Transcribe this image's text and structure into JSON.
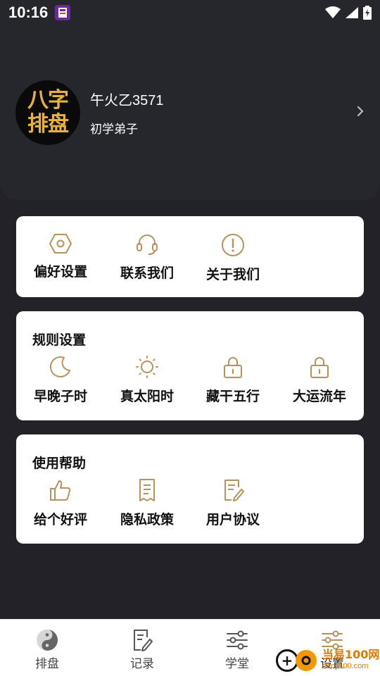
{
  "status_bar": {
    "time": "10:16"
  },
  "profile": {
    "avatar_line1": "八字",
    "avatar_line2": "排盘",
    "name": "午火乙3571",
    "level": "初学弟子"
  },
  "quick_card": {
    "items": [
      {
        "label": "偏好设置",
        "icon": "hexagon-nut-icon"
      },
      {
        "label": "联系我们",
        "icon": "headset-icon"
      },
      {
        "label": "关于我们",
        "icon": "info-circle-icon"
      }
    ]
  },
  "rules_card": {
    "title": "规则设置",
    "items": [
      {
        "label": "早晚子时",
        "icon": "moon-icon"
      },
      {
        "label": "真太阳时",
        "icon": "sun-icon"
      },
      {
        "label": "藏干五行",
        "icon": "lock-icon"
      },
      {
        "label": "大运流年",
        "icon": "lock-icon"
      }
    ]
  },
  "help_card": {
    "title": "使用帮助",
    "items": [
      {
        "label": "给个好评",
        "icon": "thumbs-up-icon"
      },
      {
        "label": "隐私政策",
        "icon": "document-icon"
      },
      {
        "label": "用户协议",
        "icon": "edit-document-icon"
      }
    ]
  },
  "bottom_nav": {
    "items": [
      {
        "label": "排盘",
        "icon": "yin-yang-icon"
      },
      {
        "label": "记录",
        "icon": "edit-note-icon"
      },
      {
        "label": "学堂",
        "icon": "sliders-icon"
      },
      {
        "label": "设置",
        "icon": "sliders-icon"
      }
    ]
  },
  "watermark": {
    "main": "当易100网",
    "sub": "danji100.com"
  },
  "colors": {
    "accent_gold": "#B8925A",
    "background": "#222228",
    "card": "#FFFFFF"
  }
}
